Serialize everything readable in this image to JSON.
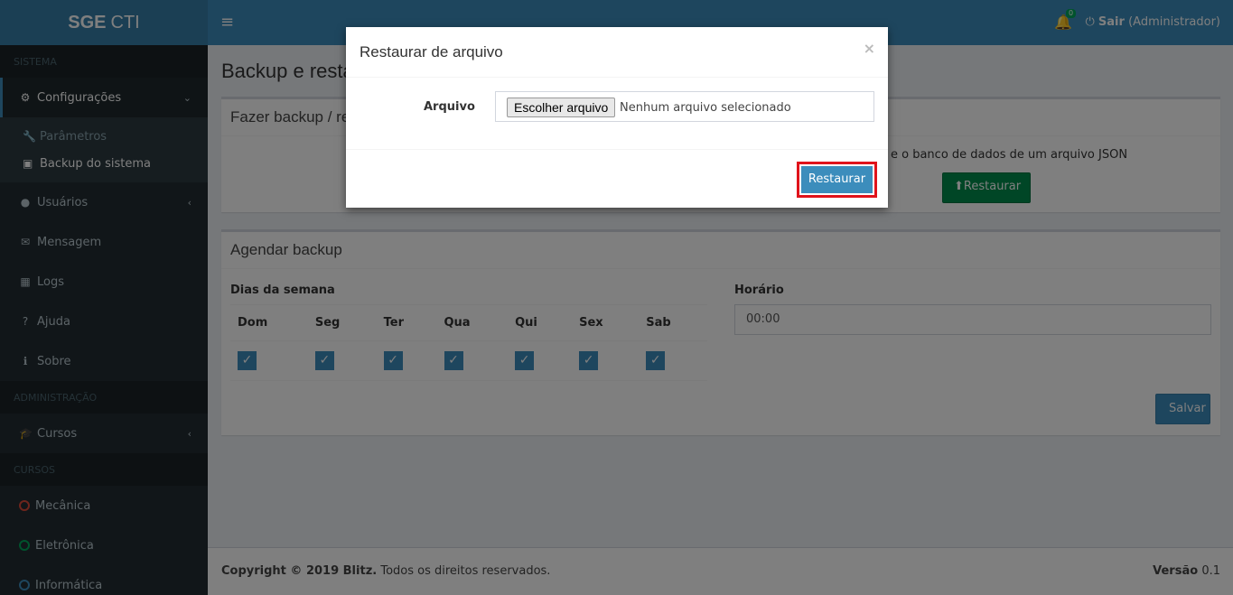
{
  "brand": {
    "bold": "SGE",
    "light": "CTI"
  },
  "header": {
    "badge_count": "0",
    "logout_label": "Sair",
    "logout_user": "(Administrador)"
  },
  "sidebar": {
    "section_sistema": "SISTEMA",
    "configuracoes": "Configurações",
    "sub_parametros": "Parâmetros",
    "sub_backup": "Backup do sistema",
    "usuarios": "Usuários",
    "mensagem": "Mensagem",
    "logs": "Logs",
    "ajuda": "Ajuda",
    "sobre": "Sobre",
    "section_admin": "ADMINISTRAÇÃO",
    "cursos": "Cursos",
    "section_cursos": "CURSOS",
    "mecanica": "Mecânica",
    "eletronica": "Eletrônica",
    "informatica": "Informática",
    "colors": {
      "mecanica": "#dd4b39",
      "eletronica": "#00a65a",
      "informatica": "#3c8dbc"
    }
  },
  "page": {
    "title": "Backup e resta",
    "box1_title": "Fazer backup / re",
    "box1_desc": "e o banco de dados de um arquivo JSON",
    "restore_button": "Restaurar",
    "box2_title": "Agendar backup",
    "days_label": "Dias da semana",
    "days": [
      "Dom",
      "Seg",
      "Ter",
      "Qua",
      "Qui",
      "Sex",
      "Sab"
    ],
    "time_label": "Horário",
    "time_value": "00:00",
    "save_button": "Salvar"
  },
  "footer": {
    "copyright": "Copyright © 2019 Blitz.",
    "rights": "Todos os direitos reservados.",
    "version_label": "Versão",
    "version_value": "0.1"
  },
  "modal": {
    "title": "Restaurar de arquivo",
    "close": "×",
    "file_label": "Arquivo",
    "file_button": "Escolher arquivo",
    "file_status": "Nenhum arquivo selecionado",
    "submit": "Restaurar"
  }
}
